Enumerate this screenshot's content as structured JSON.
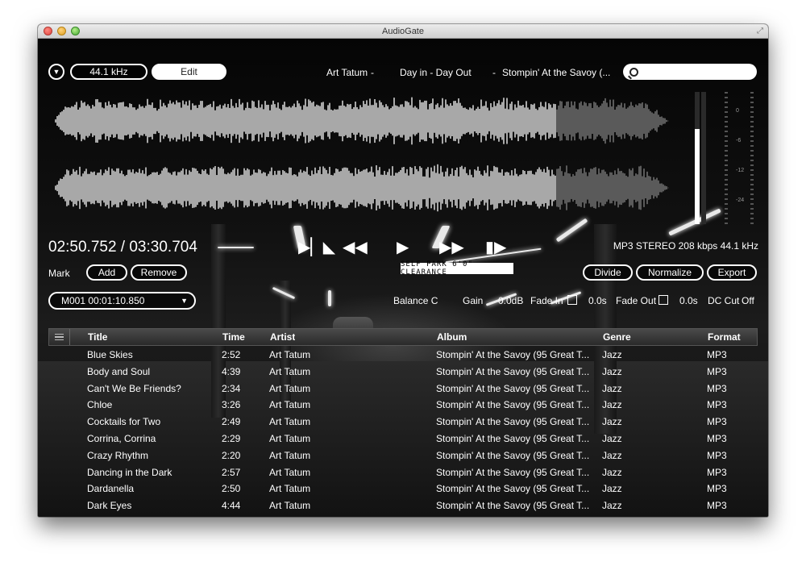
{
  "window": {
    "title": "AudioGate"
  },
  "toolbar": {
    "sample_rate": "44.1 kHz",
    "edit_label": "Edit",
    "now_playing": {
      "artist": "Art Tatum",
      "sep1": "-",
      "title": "Day in - Day Out",
      "sep2": "-",
      "album": "Stompin' At the Savoy (..."
    },
    "search_placeholder": ""
  },
  "meter": {
    "scale_labels": [
      "0",
      "-6",
      "-12",
      "-24"
    ],
    "left_level": 0.72,
    "right_level": 0.0
  },
  "playback": {
    "position": "02:50.752 / 03:30.704",
    "format_info": "MP3 STEREO 208 kbps 44.1 kHz",
    "progress": 0.81
  },
  "marks": {
    "label": "Mark",
    "add_label": "Add",
    "remove_label": "Remove",
    "selected_marker": "M001 00:01:10.850"
  },
  "actions": {
    "divide_label": "Divide",
    "normalize_label": "Normalize",
    "export_label": "Export"
  },
  "effects": {
    "balance_label": "Balance C",
    "gain_label": "Gain",
    "gain_value": "0.0dB",
    "fade_in_label": "Fade In",
    "fade_in_value": "0.0s",
    "fade_out_label": "Fade Out",
    "fade_out_value": "0.0s",
    "dc_cut_label": "DC Cut",
    "dc_cut_value": "Off"
  },
  "background_sign": "SELF PARK 6'0\" CLEARANCE",
  "table": {
    "headers": {
      "title": "Title",
      "time": "Time",
      "artist": "Artist",
      "album": "Album",
      "genre": "Genre",
      "format": "Format"
    },
    "rows": [
      {
        "title": "Blue Skies",
        "time": "2:52",
        "artist": "Art Tatum",
        "album": "Stompin' At the Savoy (95 Great T...",
        "genre": "Jazz",
        "format": "MP3"
      },
      {
        "title": "Body and Soul",
        "time": "4:39",
        "artist": "Art Tatum",
        "album": "Stompin' At the Savoy (95 Great T...",
        "genre": "Jazz",
        "format": "MP3"
      },
      {
        "title": "Can't We Be Friends?",
        "time": "2:34",
        "artist": "Art Tatum",
        "album": "Stompin' At the Savoy (95 Great T...",
        "genre": "Jazz",
        "format": "MP3"
      },
      {
        "title": "Chloe",
        "time": "3:26",
        "artist": "Art Tatum",
        "album": "Stompin' At the Savoy (95 Great T...",
        "genre": "Jazz",
        "format": "MP3"
      },
      {
        "title": "Cocktails for Two",
        "time": "2:49",
        "artist": "Art Tatum",
        "album": "Stompin' At the Savoy (95 Great T...",
        "genre": "Jazz",
        "format": "MP3"
      },
      {
        "title": "Corrina, Corrina",
        "time": "2:29",
        "artist": "Art Tatum",
        "album": "Stompin' At the Savoy (95 Great T...",
        "genre": "Jazz",
        "format": "MP3"
      },
      {
        "title": "Crazy Rhythm",
        "time": "2:20",
        "artist": "Art Tatum",
        "album": "Stompin' At the Savoy (95 Great T...",
        "genre": "Jazz",
        "format": "MP3"
      },
      {
        "title": "Dancing in the Dark",
        "time": "2:57",
        "artist": "Art Tatum",
        "album": "Stompin' At the Savoy (95 Great T...",
        "genre": "Jazz",
        "format": "MP3"
      },
      {
        "title": "Dardanella",
        "time": "2:50",
        "artist": "Art Tatum",
        "album": "Stompin' At the Savoy (95 Great T...",
        "genre": "Jazz",
        "format": "MP3"
      },
      {
        "title": "Dark Eyes",
        "time": "4:44",
        "artist": "Art Tatum",
        "album": "Stompin' At the Savoy (95 Great T...",
        "genre": "Jazz",
        "format": "MP3"
      }
    ]
  }
}
